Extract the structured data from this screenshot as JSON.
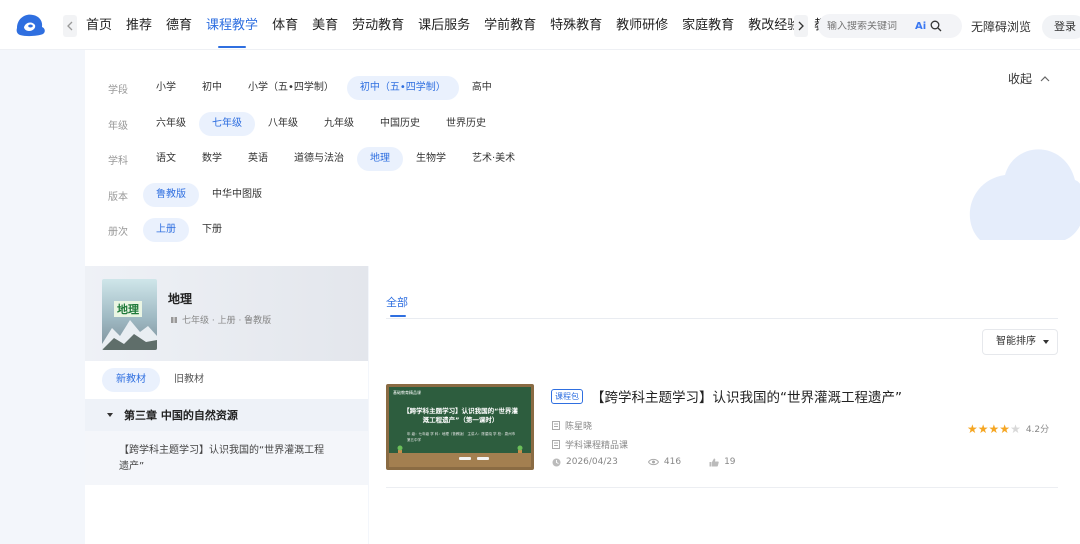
{
  "nav": {
    "items": [
      "首页",
      "推荐",
      "德育",
      "课程教学",
      "体育",
      "美育",
      "劳动教育",
      "课后服务",
      "学前教育",
      "特殊教育",
      "教师研修",
      "家庭教育",
      "教改经验",
      "教材"
    ],
    "active_index": 3,
    "search_placeholder": "输入搜索关键词",
    "ai_label": "Ai",
    "accessibility": "无障碍浏览",
    "login": "登录"
  },
  "filters": {
    "collapse_label": "收起",
    "rows": [
      {
        "label": "学段",
        "options": [
          "小学",
          "初中",
          "小学（五•四学制）",
          "初中（五•四学制）",
          "高中"
        ],
        "active": 3
      },
      {
        "label": "年级",
        "options": [
          "六年级",
          "七年级",
          "八年级",
          "九年级",
          "中国历史",
          "世界历史"
        ],
        "active": 1
      },
      {
        "label": "学科",
        "options": [
          "语文",
          "数学",
          "英语",
          "道德与法治",
          "地理",
          "生物学",
          "艺术·美术"
        ],
        "active": 4
      },
      {
        "label": "版本",
        "options": [
          "鲁教版",
          "中华中图版"
        ],
        "active": 0
      },
      {
        "label": "册次",
        "options": [
          "上册",
          "下册"
        ],
        "active": 0
      }
    ]
  },
  "book": {
    "cover_title": "地理",
    "title": "地理",
    "meta": "七年级 · 上册 · 鲁教版",
    "tabs": [
      "新教材",
      "旧教材"
    ],
    "active_tab": 0,
    "chapter": "第三章 中国的自然资源",
    "lesson": "【跨学科主题学习】认识我国的“世界灌溉工程遗产”"
  },
  "content": {
    "tab_all": "全部",
    "sort_label": "智能排序",
    "card": {
      "thumb_tag": "基础教育精品课",
      "thumb_title": "【跨学科主题学习】认识我国的“世界灌溉工程遗产”（第一课时）",
      "thumb_info": "年 级：七年级    学 科：地理（鲁教版） 主讲人：陈星晓    学 校：泉州市第五中学",
      "badge": "课程包",
      "title": "【跨学科主题学习】认识我国的“世界灌溉工程遗产”",
      "author": "陈星晓",
      "category": "学科课程精品课",
      "date": "2026/04/23",
      "views": "416",
      "likes": "19",
      "rating": 4,
      "score": "4.2分",
      "star_color": "#f5a623"
    }
  },
  "colors": {
    "accent": "#2f6fe0"
  }
}
